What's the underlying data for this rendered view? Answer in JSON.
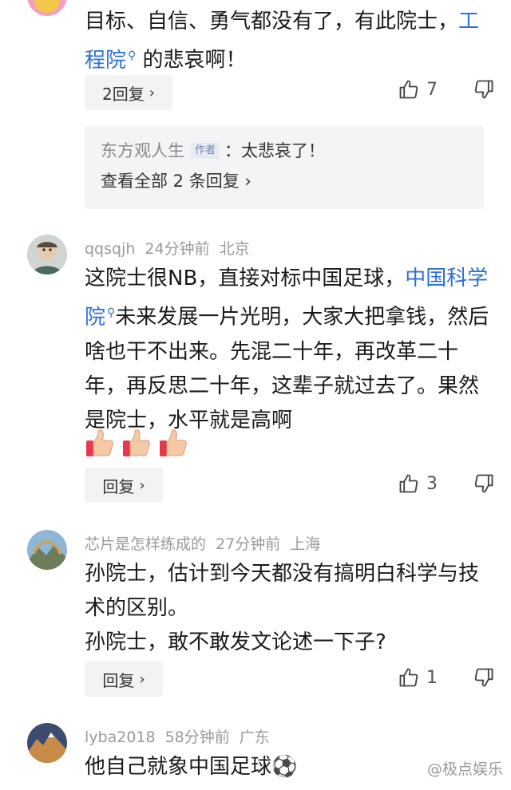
{
  "comments": [
    {
      "text_a": "目标、自信、勇气都没有了，有此院士，",
      "link": "工程院",
      "text_b": " 的悲哀啊！",
      "reply_label": "2回复",
      "likes": "7",
      "sub_reply": {
        "author": "东方观人生",
        "badge": "作者",
        "text": "：太悲哀了！",
        "view_all": "查看全部 2 条回复"
      }
    },
    {
      "username": "qqsqjh",
      "time": "24分钟前",
      "location": "北京",
      "text_a": "这院士很NB，直接对标中国足球，",
      "link": "中国科学院",
      "text_b": "未来发展一片光明，大家大把拿钱，然后啥也干不出来。先混二十年，再改革二十年，再反思二十年，这辈子就过去了。果然是院士，水平就是高啊",
      "reply_label": "回复",
      "likes": "3"
    },
    {
      "username": "芯片是怎样练成的",
      "time": "27分钟前",
      "location": "上海",
      "line1": "孙院士，估计到今天都没有搞明白科学与技术的区别。",
      "line2": "孙院士，敢不敢发文论述一下子?",
      "reply_label": "回复",
      "likes": "1"
    },
    {
      "username": "lyba2018",
      "time": "58分钟前",
      "location": "广东",
      "text": "他自己就象中国足球⚽"
    }
  ],
  "watermark": "@极点娱乐",
  "colors": {
    "link": "#2f6fd6",
    "meta": "#9a9a9a",
    "button_bg": "#f2f3f5"
  }
}
